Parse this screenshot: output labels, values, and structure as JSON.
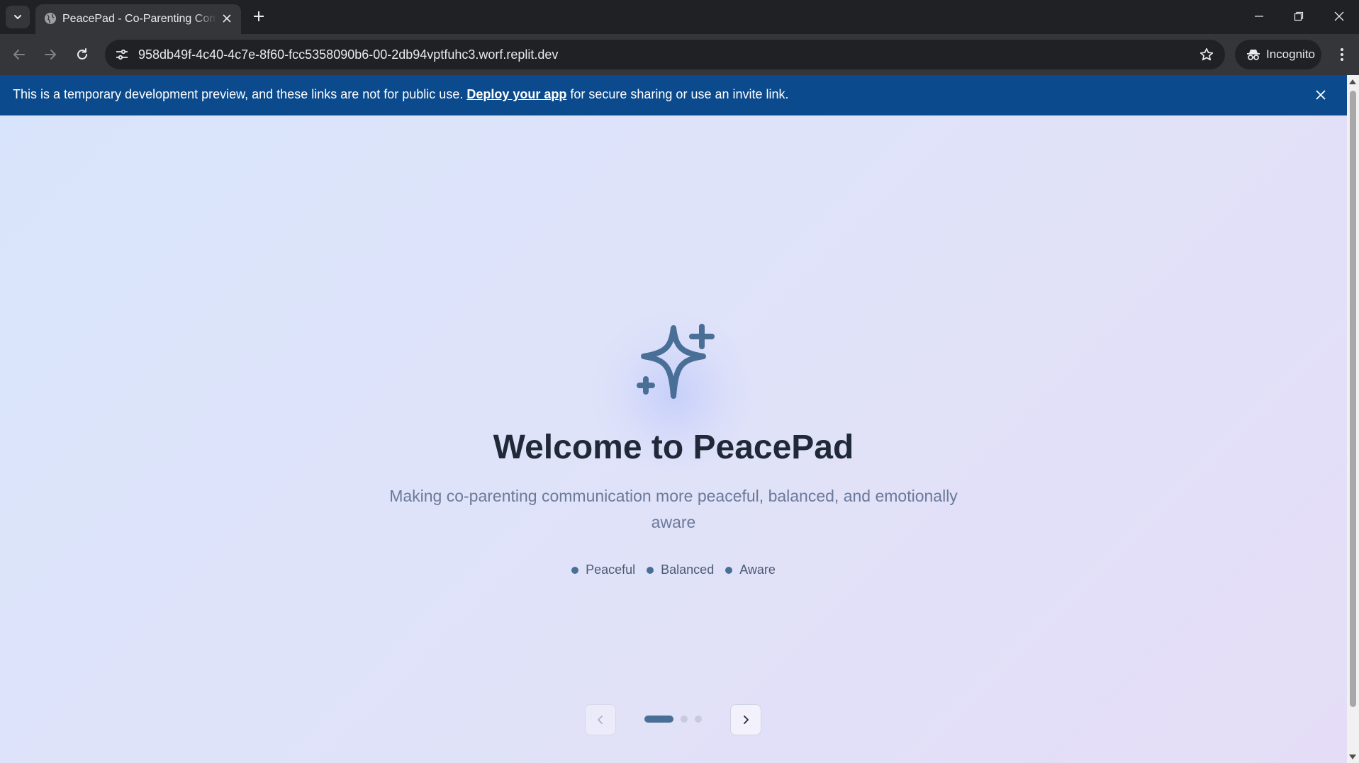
{
  "browser": {
    "tab": {
      "title": "PeacePad - Co-Parenting Communication",
      "favicon": "globe-icon"
    },
    "url": "958db49f-4c40-4c7e-8f60-fcc5358090b6-00-2db94vptfuhc3.worf.replit.dev",
    "incognito_label": "Incognito"
  },
  "banner": {
    "text_before": "This is a temporary development preview, and these links are not for public use. ",
    "link": "Deploy your app",
    "text_after": " for secure sharing or use an invite link."
  },
  "hero": {
    "icon": "sparkles-icon",
    "accent_color": "#4a6f96",
    "title": "Welcome to PeacePad",
    "subtitle": "Making co-parenting communication more peaceful, balanced, and emotionally aware",
    "tags": [
      "Peaceful",
      "Balanced",
      "Aware"
    ]
  },
  "pager": {
    "total_slides": 3,
    "current_slide": 1
  }
}
